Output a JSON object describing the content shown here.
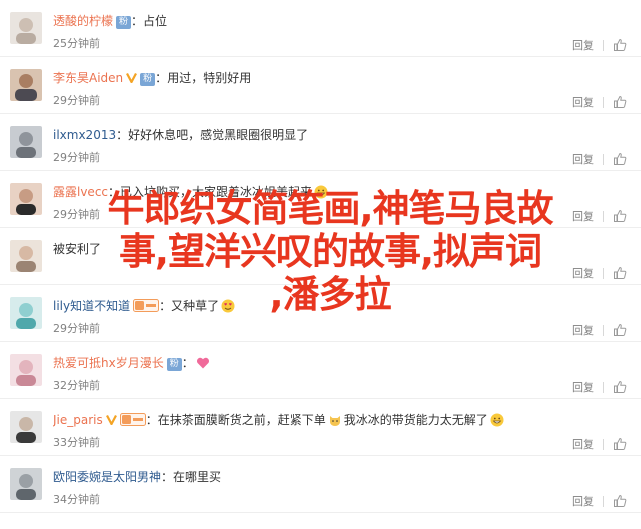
{
  "reply_label": "回复",
  "colors": {
    "name_orange": "#eb7350",
    "name_blue": "#2f5b8f",
    "meta_gray": "#808080",
    "headline_red": "#e8361f"
  },
  "comments": [
    {
      "name": "透酸的柠檬",
      "name_style": "orange",
      "badge": "fan",
      "badge_text": "粉",
      "text": "占位",
      "time": "25分钟前",
      "avatar": "light"
    },
    {
      "name": "李东昊Aiden",
      "name_style": "orange",
      "vip": true,
      "badge": "fan",
      "badge_text": "粉",
      "text": "用过，特别好用",
      "time": "29分钟前",
      "avatar": "warm"
    },
    {
      "name": "ilxmx2013",
      "name_style": "blue",
      "text": "好好休息吧，感觉黑眼圈很明显了",
      "time": "29分钟前",
      "avatar": "gray"
    },
    {
      "name": "露露lvecc",
      "name_style": "orange",
      "text": "已入坑购买，大家跟着冰冰姐美起来",
      "emoji_after": "grin-icon",
      "time": "29分钟前",
      "avatar": "warm"
    },
    {
      "name": "",
      "name_style": "orange",
      "text": "被安利了",
      "time": "",
      "avatar": "light"
    },
    {
      "name": "lily知道不知道",
      "name_style": "blue",
      "badge": "grade",
      "text": "又种草了",
      "emoji_after": "heart-eyes-icon",
      "time": "29分钟前",
      "avatar": "teal"
    },
    {
      "name": "热爱可抵hx岁月漫长",
      "name_style": "orange",
      "badge": "fan",
      "badge_text": "粉",
      "text": "",
      "emoji_after": "heart-icon",
      "time": "32分钟前",
      "avatar": "pink"
    },
    {
      "name": "Jie_paris",
      "name_style": "orange",
      "vip": true,
      "badge": "grade",
      "text": "在抹茶面膜断货之前，赶紧下单",
      "mid_emoji": "cat-icon",
      "text2": "我冰冰的带货能力太无解了",
      "emoji_after": "grin-icon",
      "time": "33分钟前",
      "avatar": "light"
    },
    {
      "name": "欧阳委婉是太阳男神",
      "name_style": "blue",
      "text": "在哪里买",
      "time": "34分钟前",
      "avatar": "gray"
    }
  ],
  "overlay": {
    "line1": "牛郎织女简笔画,神笔马良故",
    "line2": "事,望洋兴叹的故事,拟声词",
    "line3": ",潘多拉"
  }
}
